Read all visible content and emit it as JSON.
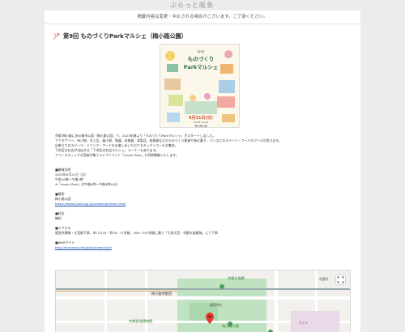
{
  "header": {
    "brand": "ぶらっと阪急"
  },
  "notice": "掲載内容は変更・中止される場合がございます。ご了承ください。",
  "event": {
    "title": "第9回 ものづくりParkマルシェ（梅小路公園）",
    "poster": {
      "title_line1": "ものづくり",
      "title_line2": "Parkマルシェ",
      "number": "第9回",
      "date": "9月21日(日)",
      "time": "10:00-16:00",
      "venue": "梅小路公園"
    },
    "intro": [
      "京都 梅小路にある都市公園「梅小路公園」で、2023年春より「ものづくりParkマルシェ」がスタートしました。",
      "アクセサリー、布小物、木工品、器小物、陶器、花雑貨、革製品、紙雑貨などのものづくり雑貨や焼き菓子、パンなどのスイーツ・フードのブースが並びます。",
      "出来立てのスイーツ・ドリンク・フードをお楽しみいただけるキッチンカーも大集合。",
      "下京区のお店が出店する「下京区のお店マルシェ」コーナーもあります。",
      "アコースティックな音楽が集うライブイベント「music Park」も同時開催いたします。"
    ],
    "date_heading": "■開催日時",
    "date_lines": [
      "2025年9月21日（日）",
      "午前10時〜午後4時",
      "※「music Park」は午後0時〜午後3時40分"
    ],
    "venue_heading": "■場所",
    "venue_name": "梅小路公園",
    "venue_url": "https://www.kyoto-ga.jp/umekouji/index.html",
    "fee_heading": "■料金",
    "fee": "無料",
    "access_heading": "■アクセス",
    "access": "阪急京都線・大宮駅下車、市バス18・特18・71系統、206・207系統に乗り「七条大宮・京都水族館前」にて下車",
    "web_heading": "■WEBサイト",
    "web_url": "http://monooro.info/park/index.html"
  },
  "map": {
    "labels": {
      "station": "梅小路京都西",
      "aquarium": "京都水族館",
      "railway_museum": "京都鉄道博物館",
      "park": "梅小路公園",
      "road": "七条通",
      "hanayacho": "花屋町",
      "park_label": "梅小路公園",
      "line_label": "JR",
      "kankiji": "観喜寺町",
      "road2": "1",
      "hotel": "ホテル",
      "area": "七条大宮"
    }
  }
}
